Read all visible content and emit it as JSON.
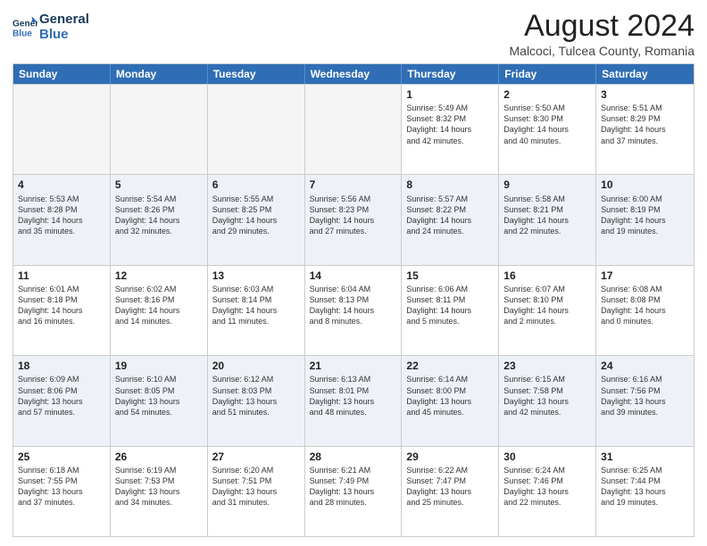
{
  "logo": {
    "line1": "General",
    "line2": "Blue"
  },
  "title": "August 2024",
  "subtitle": "Malcoci, Tulcea County, Romania",
  "header_days": [
    "Sunday",
    "Monday",
    "Tuesday",
    "Wednesday",
    "Thursday",
    "Friday",
    "Saturday"
  ],
  "rows": [
    {
      "alt": false,
      "cells": [
        {
          "day": "",
          "info": ""
        },
        {
          "day": "",
          "info": ""
        },
        {
          "day": "",
          "info": ""
        },
        {
          "day": "",
          "info": ""
        },
        {
          "day": "1",
          "info": "Sunrise: 5:49 AM\nSunset: 8:32 PM\nDaylight: 14 hours\nand 42 minutes."
        },
        {
          "day": "2",
          "info": "Sunrise: 5:50 AM\nSunset: 8:30 PM\nDaylight: 14 hours\nand 40 minutes."
        },
        {
          "day": "3",
          "info": "Sunrise: 5:51 AM\nSunset: 8:29 PM\nDaylight: 14 hours\nand 37 minutes."
        }
      ]
    },
    {
      "alt": true,
      "cells": [
        {
          "day": "4",
          "info": "Sunrise: 5:53 AM\nSunset: 8:28 PM\nDaylight: 14 hours\nand 35 minutes."
        },
        {
          "day": "5",
          "info": "Sunrise: 5:54 AM\nSunset: 8:26 PM\nDaylight: 14 hours\nand 32 minutes."
        },
        {
          "day": "6",
          "info": "Sunrise: 5:55 AM\nSunset: 8:25 PM\nDaylight: 14 hours\nand 29 minutes."
        },
        {
          "day": "7",
          "info": "Sunrise: 5:56 AM\nSunset: 8:23 PM\nDaylight: 14 hours\nand 27 minutes."
        },
        {
          "day": "8",
          "info": "Sunrise: 5:57 AM\nSunset: 8:22 PM\nDaylight: 14 hours\nand 24 minutes."
        },
        {
          "day": "9",
          "info": "Sunrise: 5:58 AM\nSunset: 8:21 PM\nDaylight: 14 hours\nand 22 minutes."
        },
        {
          "day": "10",
          "info": "Sunrise: 6:00 AM\nSunset: 8:19 PM\nDaylight: 14 hours\nand 19 minutes."
        }
      ]
    },
    {
      "alt": false,
      "cells": [
        {
          "day": "11",
          "info": "Sunrise: 6:01 AM\nSunset: 8:18 PM\nDaylight: 14 hours\nand 16 minutes."
        },
        {
          "day": "12",
          "info": "Sunrise: 6:02 AM\nSunset: 8:16 PM\nDaylight: 14 hours\nand 14 minutes."
        },
        {
          "day": "13",
          "info": "Sunrise: 6:03 AM\nSunset: 8:14 PM\nDaylight: 14 hours\nand 11 minutes."
        },
        {
          "day": "14",
          "info": "Sunrise: 6:04 AM\nSunset: 8:13 PM\nDaylight: 14 hours\nand 8 minutes."
        },
        {
          "day": "15",
          "info": "Sunrise: 6:06 AM\nSunset: 8:11 PM\nDaylight: 14 hours\nand 5 minutes."
        },
        {
          "day": "16",
          "info": "Sunrise: 6:07 AM\nSunset: 8:10 PM\nDaylight: 14 hours\nand 2 minutes."
        },
        {
          "day": "17",
          "info": "Sunrise: 6:08 AM\nSunset: 8:08 PM\nDaylight: 14 hours\nand 0 minutes."
        }
      ]
    },
    {
      "alt": true,
      "cells": [
        {
          "day": "18",
          "info": "Sunrise: 6:09 AM\nSunset: 8:06 PM\nDaylight: 13 hours\nand 57 minutes."
        },
        {
          "day": "19",
          "info": "Sunrise: 6:10 AM\nSunset: 8:05 PM\nDaylight: 13 hours\nand 54 minutes."
        },
        {
          "day": "20",
          "info": "Sunrise: 6:12 AM\nSunset: 8:03 PM\nDaylight: 13 hours\nand 51 minutes."
        },
        {
          "day": "21",
          "info": "Sunrise: 6:13 AM\nSunset: 8:01 PM\nDaylight: 13 hours\nand 48 minutes."
        },
        {
          "day": "22",
          "info": "Sunrise: 6:14 AM\nSunset: 8:00 PM\nDaylight: 13 hours\nand 45 minutes."
        },
        {
          "day": "23",
          "info": "Sunrise: 6:15 AM\nSunset: 7:58 PM\nDaylight: 13 hours\nand 42 minutes."
        },
        {
          "day": "24",
          "info": "Sunrise: 6:16 AM\nSunset: 7:56 PM\nDaylight: 13 hours\nand 39 minutes."
        }
      ]
    },
    {
      "alt": false,
      "cells": [
        {
          "day": "25",
          "info": "Sunrise: 6:18 AM\nSunset: 7:55 PM\nDaylight: 13 hours\nand 37 minutes."
        },
        {
          "day": "26",
          "info": "Sunrise: 6:19 AM\nSunset: 7:53 PM\nDaylight: 13 hours\nand 34 minutes."
        },
        {
          "day": "27",
          "info": "Sunrise: 6:20 AM\nSunset: 7:51 PM\nDaylight: 13 hours\nand 31 minutes."
        },
        {
          "day": "28",
          "info": "Sunrise: 6:21 AM\nSunset: 7:49 PM\nDaylight: 13 hours\nand 28 minutes."
        },
        {
          "day": "29",
          "info": "Sunrise: 6:22 AM\nSunset: 7:47 PM\nDaylight: 13 hours\nand 25 minutes."
        },
        {
          "day": "30",
          "info": "Sunrise: 6:24 AM\nSunset: 7:46 PM\nDaylight: 13 hours\nand 22 minutes."
        },
        {
          "day": "31",
          "info": "Sunrise: 6:25 AM\nSunset: 7:44 PM\nDaylight: 13 hours\nand 19 minutes."
        }
      ]
    }
  ]
}
